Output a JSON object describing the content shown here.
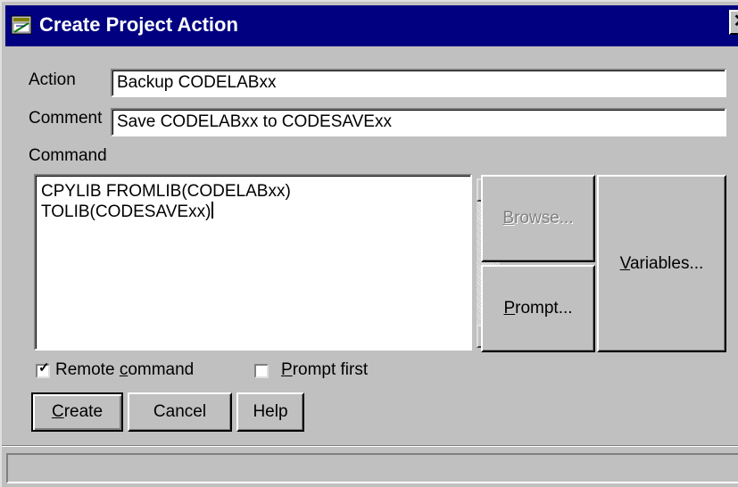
{
  "window": {
    "title": "Create Project Action",
    "close_glyph": "✕"
  },
  "form": {
    "action_label": "Action",
    "action_value": "Backup CODELABxx",
    "comment_label": "Comment",
    "comment_value": "Save CODELABxx to CODESAVExx",
    "command_label": "Command",
    "command_lines": [
      "CPYLIB FROMLIB(CODELABxx)",
      "TOLIB(CODESAVExx)"
    ]
  },
  "buttons": {
    "browse": {
      "mnemonic": "B",
      "rest": "rowse...",
      "enabled": false
    },
    "variables": {
      "mnemonic": "V",
      "rest": "ariables..."
    },
    "prompt": {
      "mnemonic": "P",
      "rest": "rompt..."
    },
    "create": {
      "mnemonic": "C",
      "rest": "reate"
    },
    "cancel": "Cancel",
    "help": "Help"
  },
  "options": {
    "remote_command": {
      "pre": "Remote ",
      "mnemonic": "c",
      "post": "ommand",
      "checked": true
    },
    "prompt_first": {
      "pre": "",
      "mnemonic": "P",
      "post": "rompt first",
      "checked": false
    }
  },
  "status": {
    "text": ""
  },
  "icons": {
    "title": "project-window-icon",
    "check": "✓"
  },
  "colors": {
    "titlebar": "#000080",
    "face": "#c0c0c0"
  }
}
